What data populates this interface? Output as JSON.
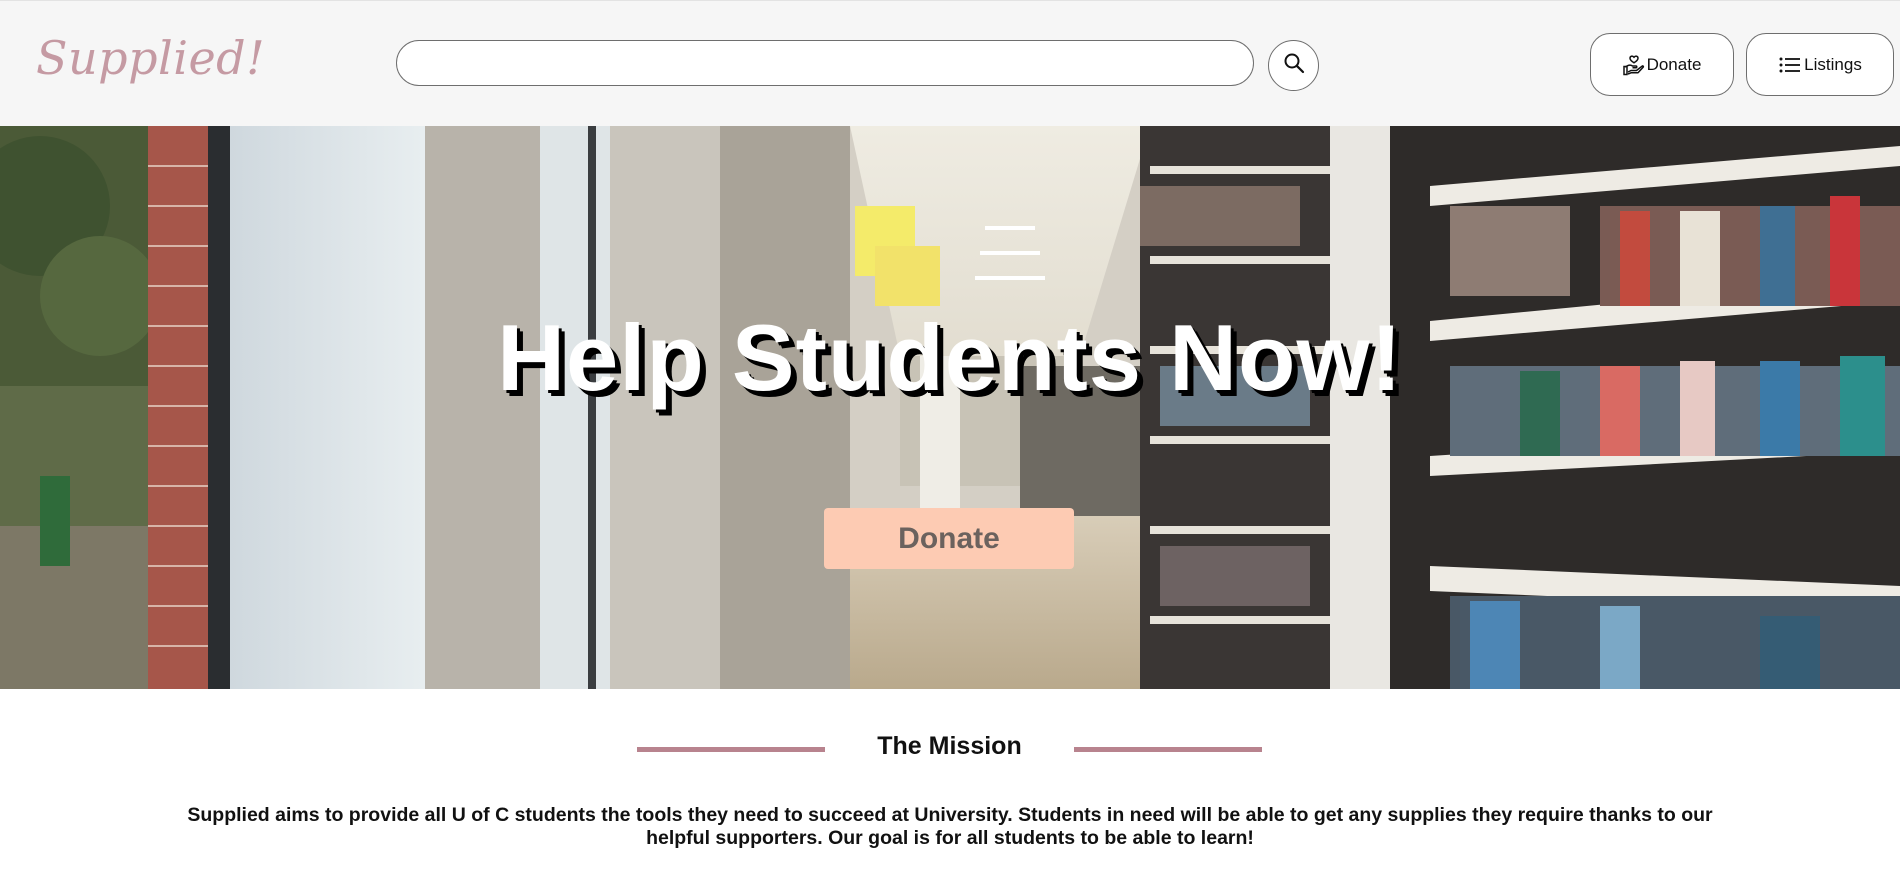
{
  "brand": {
    "logo_text": "Supplied!",
    "logo_color": "#c59aa3"
  },
  "search": {
    "placeholder": "",
    "value": "",
    "button_icon": "search-icon"
  },
  "nav": {
    "donate_label": "Donate",
    "donate_icon": "donate-hand-icon",
    "listings_label": "Listings",
    "listings_icon": "list-icon"
  },
  "hero": {
    "title": "Help Students Now!",
    "donate_label": "Donate",
    "donate_color": "#fdcbb3",
    "background": "library-bookshelves-photo"
  },
  "mission": {
    "title": "The Mission",
    "rule_color": "#b8838e",
    "text": "Supplied aims to provide all U of C students the tools they need to succeed at University. Students in need will be able to get any supplies they require thanks to our helpful supporters. Our goal is for all students to be able to learn!"
  }
}
